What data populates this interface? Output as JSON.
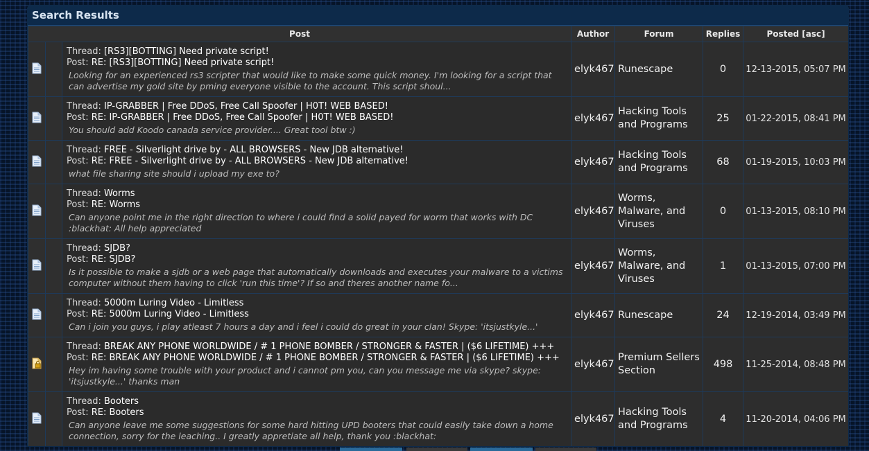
{
  "panel": {
    "title": "Search Results"
  },
  "columns": {
    "post": "Post",
    "author": "Author",
    "forum": "Forum",
    "replies": "Replies",
    "posted": "Posted [asc]"
  },
  "labels": {
    "thread": "Thread: ",
    "post": "Post: "
  },
  "rows": [
    {
      "icon": "document-icon",
      "thread": "[RS3][BOTTING] Need private script!",
      "post": "RE: [RS3][BOTTING] Need private script!",
      "snippet": "Looking for an experienced rs3 scripter that would like to make some quick money. I'm looking for a script that can advertise my gold site by pming everyone visible to the account. This script shoul...",
      "author": "elyk467",
      "forum": "Runescape",
      "replies": "0",
      "posted": "12-13-2015, 05:07 PM"
    },
    {
      "icon": "document-icon",
      "thread": "IP-GRABBER | Free DDoS, Free Call Spoofer | H0T! WEB BASED!",
      "post": "RE: IP-GRABBER | Free DDoS, Free Call Spoofer | H0T! WEB BASED!",
      "snippet": "You should add Koodo canada service provider.... Great tool btw :)",
      "author": "elyk467",
      "forum": "Hacking Tools and Programs",
      "replies": "25",
      "posted": "01-22-2015, 08:41 PM"
    },
    {
      "icon": "document-icon",
      "thread": "FREE - Silverlight drive by - ALL BROWSERS - New JDB alternative!",
      "post": "RE: FREE - Silverlight drive by - ALL BROWSERS - New JDB alternative!",
      "snippet": "what file sharing site should i upload my exe to?",
      "author": "elyk467",
      "forum": "Hacking Tools and Programs",
      "replies": "68",
      "posted": "01-19-2015, 10:03 PM"
    },
    {
      "icon": "document-icon",
      "thread": "Worms",
      "post": "RE: Worms",
      "snippet": "Can anyone point me in the right direction to where i could find a solid payed for worm that works with DC :blackhat: All help appreciated",
      "author": "elyk467",
      "forum": "Worms, Malware, and Viruses",
      "replies": "0",
      "posted": "01-13-2015, 08:10 PM"
    },
    {
      "icon": "document-icon",
      "thread": "SJDB?",
      "post": "RE: SJDB?",
      "snippet": "Is it possible to make a sjdb or a web page that automatically downloads and executes your malware to a victims computer without them having to click 'run this time'? If so and theres another name fo...",
      "author": "elyk467",
      "forum": "Worms, Malware, and Viruses",
      "replies": "1",
      "posted": "01-13-2015, 07:00 PM"
    },
    {
      "icon": "document-icon",
      "thread": "5000m Luring Video - Limitless",
      "post": "RE: 5000m Luring Video - Limitless",
      "snippet": "Can i join you guys, i play atleast 7 hours a day and i feel i could do great in your clan! Skype: 'itsjustkyle...'",
      "author": "elyk467",
      "forum": "Runescape",
      "replies": "24",
      "posted": "12-19-2014, 03:49 PM"
    },
    {
      "icon": "locked-document-icon",
      "thread": "BREAK ANY PHONE WORLDWIDE / # 1 PHONE BOMBER / STRONGER & FASTER | ($6 LIFETIME) +++",
      "post": "RE: BREAK ANY PHONE WORLDWIDE / # 1 PHONE BOMBER / STRONGER & FASTER | ($6 LIFETIME) +++",
      "snippet": "Hey im having some trouble with your product and i cannot pm you, can you message me via skype? skype: 'itsjustkyle...' thanks man",
      "author": "elyk467",
      "forum": "Premium Sellers Section",
      "replies": "498",
      "posted": "11-25-2014, 08:48 PM"
    },
    {
      "icon": "document-icon",
      "thread": "Booters",
      "post": "RE: Booters",
      "snippet": "Can anyone leave me some suggestions for some hard hitting UPD booters that could easily take down a home connection, sorry for the leaching.. I greatly appretiate all help, thank you :blackhat:",
      "author": "elyk467",
      "forum": "Hacking Tools and Programs",
      "replies": "4",
      "posted": "11-20-2014, 04:06 PM"
    }
  ]
}
